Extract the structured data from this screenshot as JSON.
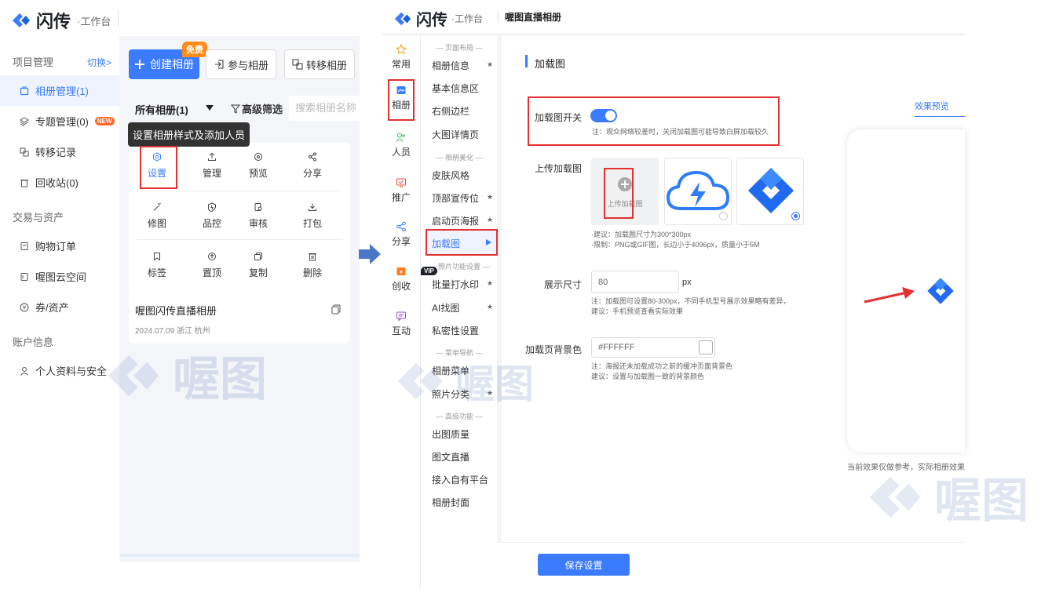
{
  "left": {
    "brand": {
      "name": "闪传",
      "sub": "·工作台"
    },
    "nav": {
      "group_project": "项目管理",
      "switch_link": "切换>",
      "items": [
        {
          "label": "相册管理(1)",
          "active": true
        },
        {
          "label": "专题管理(0)",
          "badge": "NEW"
        },
        {
          "label": "转移记录"
        },
        {
          "label": "回收站(0)"
        }
      ],
      "group_trade": "交易与资产",
      "trade_items": [
        {
          "label": "购物订单"
        },
        {
          "label": "喔图云空间"
        },
        {
          "label": "券/资产"
        }
      ],
      "group_account": "账户信息",
      "account_items": [
        {
          "label": "个人资料与安全"
        }
      ]
    },
    "toolbar": {
      "create": "创建相册",
      "free_badge": "免费",
      "join": "参与相册",
      "transfer": "转移相册"
    },
    "filter": {
      "all_albums": "所有相册(1)",
      "advanced": "高级筛选",
      "search_placeholder": "搜索相册名称"
    },
    "tooltip": "设置相册样式及添加人员",
    "actions": [
      "设置",
      "管理",
      "预览",
      "分享",
      "修图",
      "品控",
      "审核",
      "打包",
      "标签",
      "置顶",
      "复制",
      "删除"
    ],
    "album": {
      "title": "喔图闪传直播相册",
      "meta": "2024.07.09 浙江 杭州"
    }
  },
  "right": {
    "brand": {
      "name": "闪传",
      "sub": "·工作台"
    },
    "album_title": "喔图直播相册",
    "vsidebar": [
      {
        "label": "常用",
        "icon": "star-icon"
      },
      {
        "label": "相册",
        "icon": "album-icon"
      },
      {
        "label": "人员",
        "icon": "people-icon"
      },
      {
        "label": "推广",
        "icon": "promote-icon"
      },
      {
        "label": "分享",
        "icon": "share-icon"
      },
      {
        "label": "创收",
        "icon": "revenue-icon"
      },
      {
        "label": "互动",
        "icon": "interact-icon"
      }
    ],
    "vip_badge": "VIP",
    "submenu": {
      "head_layout": "— 页面布局 —",
      "layout": [
        "相册信息",
        "基本信息区",
        "右侧边栏",
        "大图详情页"
      ],
      "head_beauty": "— 相册美化 —",
      "beauty": [
        "皮肤风格",
        "顶部宣传位",
        "启动页海报",
        "加载图"
      ],
      "head_photo": "— 照片功能设置 —",
      "photo": [
        "批量打水印",
        "AI找图",
        "私密性设置"
      ],
      "head_menu": "— 菜单导航 —",
      "menu": [
        "相册菜单",
        "照片分类"
      ],
      "head_adv": "— 高级功能 —",
      "adv": [
        "出图质量",
        "图文直播",
        "接入自有平台",
        "相册封面"
      ]
    },
    "section_title": "加载图",
    "switch": {
      "label": "加载图开关",
      "on": true,
      "note": "注：观众网络较差时，关闭加载图可能导致白屏加载较久"
    },
    "upload": {
      "label": "上传加载图",
      "btn": "上传加载图",
      "note1": "·建议：加载图尺寸为300*300px",
      "note2": "·限制：PNG或GIF图，长边小于4096px，质量小于5M"
    },
    "size": {
      "label": "展示尺寸",
      "value": "80",
      "unit": "px",
      "note1": "注：加载图可设置80-300px，不同手机型号展示效果略有差异，",
      "note2": "建议：手机预览查看实际效果"
    },
    "bg": {
      "label": "加载页背景色",
      "value": "#FFFFFF",
      "note1": "注：海报还未加载成功之前的缓冲页面背景色",
      "note2": "建议：设置与加载图一致的背景颜色"
    },
    "preview_tab": "效果预览",
    "preview_note": "当前效果仅做参考，实际相册效果",
    "save": "保存设置"
  },
  "watermark": "喔图",
  "colors": {
    "accent": "#3a7bff",
    "red": "#e33030",
    "orange": "#ff8c1a"
  }
}
